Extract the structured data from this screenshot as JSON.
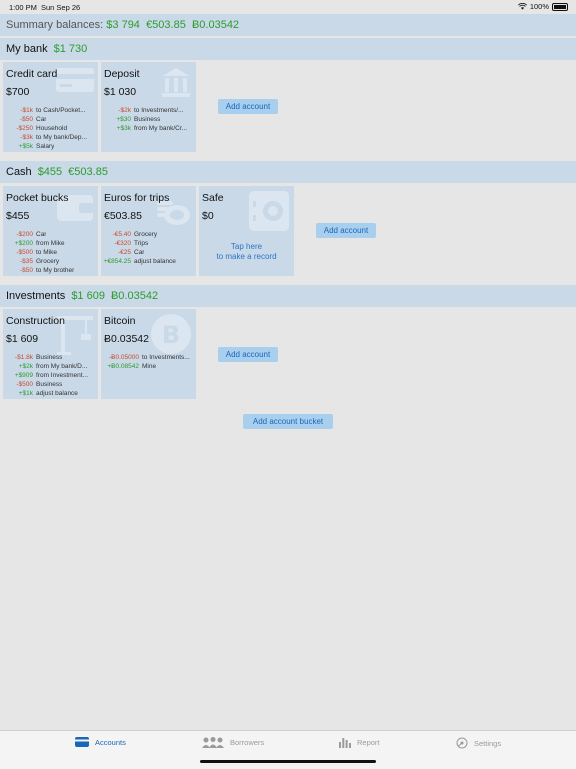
{
  "status": {
    "time": "1:00 PM",
    "date": "Sun Sep 26",
    "battery": "100%"
  },
  "summary": {
    "label": "Summary balances:",
    "values": [
      "$3 794",
      "€503.85",
      "Ƀ0.03542"
    ]
  },
  "buckets": [
    {
      "name": "My bank",
      "balances": [
        "$1 730"
      ],
      "accounts": [
        {
          "title": "Credit card",
          "balance": "$700",
          "icon": "credit-card-icon",
          "tx": [
            {
              "amount": "-$1k",
              "desc": "to Cash/Pocket..."
            },
            {
              "amount": "-$50",
              "desc": "Car"
            },
            {
              "amount": "-$250",
              "desc": "Household"
            },
            {
              "amount": "-$3k",
              "desc": "to My bank/Dep..."
            },
            {
              "amount": "+$5k",
              "desc": "Salary"
            }
          ]
        },
        {
          "title": "Deposit",
          "balance": "$1 030",
          "icon": "bank-building-icon",
          "tx": [
            {
              "amount": "-$2k",
              "desc": "to Investments/..."
            },
            {
              "amount": "+$30",
              "desc": "Business"
            },
            {
              "amount": "+$3k",
              "desc": "from My bank/Cr..."
            }
          ]
        }
      ],
      "add_label": "Add account"
    },
    {
      "name": "Cash",
      "balances": [
        "$455",
        "€503.85"
      ],
      "accounts": [
        {
          "title": "Pocket bucks",
          "balance": "$455",
          "icon": "wallet-icon",
          "tx": [
            {
              "amount": "-$200",
              "desc": "Car"
            },
            {
              "amount": "+$200",
              "desc": "from Mike"
            },
            {
              "amount": "-$500",
              "desc": "to Mike"
            },
            {
              "amount": "-$35",
              "desc": "Grocery"
            },
            {
              "amount": "-$50",
              "desc": "to My brother"
            }
          ]
        },
        {
          "title": "Euros for trips",
          "balance": "€503.85",
          "icon": "coins-icon",
          "tx": [
            {
              "amount": "-€5.40",
              "desc": "Grocery"
            },
            {
              "amount": "-€320",
              "desc": "Trips"
            },
            {
              "amount": "-€25",
              "desc": "Car"
            },
            {
              "amount": "+€854.25",
              "desc": "adjust balance"
            }
          ]
        },
        {
          "title": "Safe",
          "balance": "$0",
          "icon": "safe-icon",
          "tap_line1": "Tap here",
          "tap_line2": "to make a record",
          "tx": []
        }
      ],
      "add_label": "Add account"
    },
    {
      "name": "Investments",
      "balances": [
        "$1 609",
        "Ƀ0.03542"
      ],
      "accounts": [
        {
          "title": "Construction",
          "balance": "$1 609",
          "icon": "crane-icon",
          "tx": [
            {
              "amount": "-$1.8k",
              "desc": "Business"
            },
            {
              "amount": "+$2k",
              "desc": "from My bank/D..."
            },
            {
              "amount": "+$909",
              "desc": "from Investment..."
            },
            {
              "amount": "-$500",
              "desc": "Business"
            },
            {
              "amount": "+$1k",
              "desc": "adjust balance"
            }
          ]
        },
        {
          "title": "Bitcoin",
          "balance": "Ƀ0.03542",
          "icon": "bitcoin-icon",
          "tx": [
            {
              "amount": "-Ƀ0.05000",
              "desc": "to Investments..."
            },
            {
              "amount": "+Ƀ0.08542",
              "desc": "Mine"
            }
          ]
        }
      ],
      "add_label": "Add account"
    }
  ],
  "add_bucket_label": "Add account bucket",
  "tabs": [
    {
      "label": "Accounts",
      "icon": "card-icon",
      "active": true
    },
    {
      "label": "Borrowers",
      "icon": "people-icon",
      "active": false
    },
    {
      "label": "Report",
      "icon": "bar-chart-icon",
      "active": false
    },
    {
      "label": "Settings",
      "icon": "gear-icon",
      "active": false
    }
  ],
  "colors": {
    "header_bg": "#c9d9e8",
    "positive": "#2d9b2d",
    "negative": "#cc4a2a",
    "accent": "#1a66b8",
    "button_bg": "#a9cfef"
  }
}
